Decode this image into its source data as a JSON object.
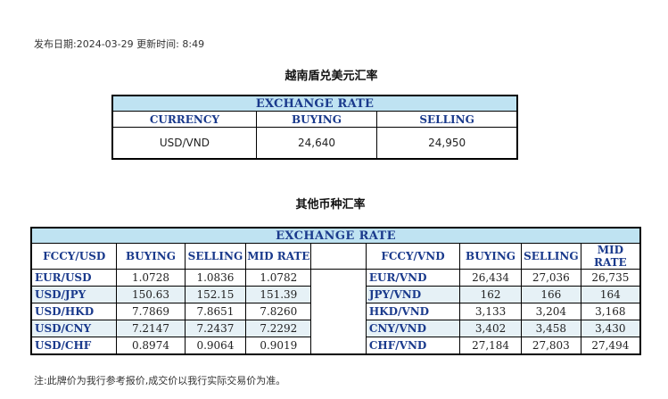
{
  "publish": {
    "label": "发布日期:",
    "date": "2024-03-29",
    "time_label": "更新时间:",
    "time": "8:49"
  },
  "section1": {
    "title": "越南盾兑美元汇率",
    "bar": "EXCHANGE RATE",
    "headers": {
      "currency": "CURRENCY",
      "buying": "BUYING",
      "selling": "SELLING"
    },
    "row": {
      "currency": "USD/VND",
      "buying": "24,640",
      "selling": "24,950"
    }
  },
  "section2": {
    "title": "其他币种汇率",
    "bar": "EXCHANGE  RATE",
    "left_headers": {
      "fccy": "FCCY/USD",
      "buying": "BUYING",
      "selling": "SELLING",
      "mid": "MID RATE"
    },
    "right_headers": {
      "fccy": "FCCY/VND",
      "buying": "BUYING",
      "selling": "SELLING",
      "mid": "MID RATE"
    },
    "rows": [
      {
        "lpair": "EUR/USD",
        "lbuy": "1.0728",
        "lsell": "1.0836",
        "lmid": "1.0782",
        "rpair": "EUR/VND",
        "rbuy": "26,434",
        "rsell": "27,036",
        "rmid": "26,735"
      },
      {
        "lpair": "USD/JPY",
        "lbuy": "150.63",
        "lsell": "152.15",
        "lmid": "151.39",
        "rpair": "JPY/VND",
        "rbuy": "162",
        "rsell": "166",
        "rmid": "164"
      },
      {
        "lpair": "USD/HKD",
        "lbuy": "7.7869",
        "lsell": "7.8651",
        "lmid": "7.8260",
        "rpair": "HKD/VND",
        "rbuy": "3,133",
        "rsell": "3,204",
        "rmid": "3,168"
      },
      {
        "lpair": "USD/CNY",
        "lbuy": "7.2147",
        "lsell": "7.2437",
        "lmid": "7.2292",
        "rpair": "CNY/VND",
        "rbuy": "3,402",
        "rsell": "3,458",
        "rmid": "3,430"
      },
      {
        "lpair": "USD/CHF",
        "lbuy": "0.8974",
        "lsell": "0.9064",
        "lmid": "0.9019",
        "rpair": "CHF/VND",
        "rbuy": "27,184",
        "rsell": "27,803",
        "rmid": "27,494"
      }
    ]
  },
  "note": "注:此牌价为我行参考报价,成交价以我行实际交易价为准。"
}
